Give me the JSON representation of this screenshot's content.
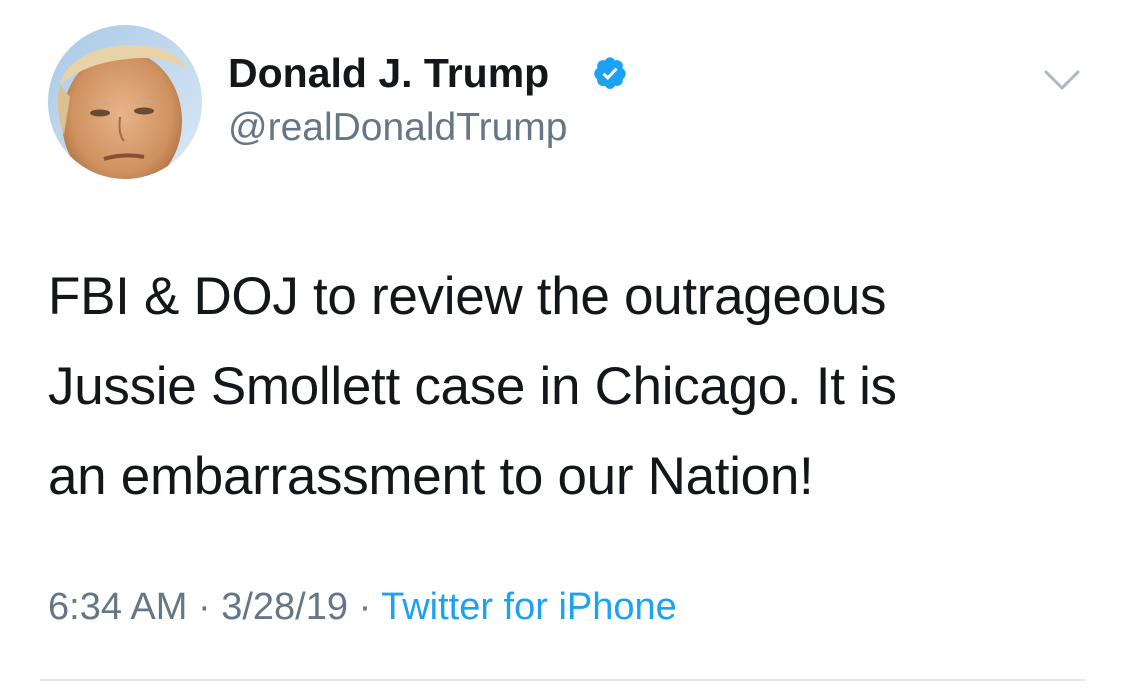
{
  "tweet": {
    "author": {
      "display_name": "Donald J. Trump",
      "handle": "@realDonaldTrump",
      "verified": true,
      "avatar_icon": "profile-photo"
    },
    "text_lines": [
      "FBI & DOJ to review the outrageous",
      "Jussie Smollett case in Chicago. It is",
      "an embarrassment to our Nation!"
    ],
    "meta": {
      "time": "6:34 AM",
      "separator": "·",
      "date": "3/28/19",
      "source": "Twitter for iPhone"
    },
    "menu_icon": "chevron-down-icon"
  },
  "colors": {
    "text": "#14171a",
    "secondary": "#657786",
    "link": "#1da1f2",
    "verified_badge": "#1da1f2",
    "divider": "#e1e8ed"
  }
}
